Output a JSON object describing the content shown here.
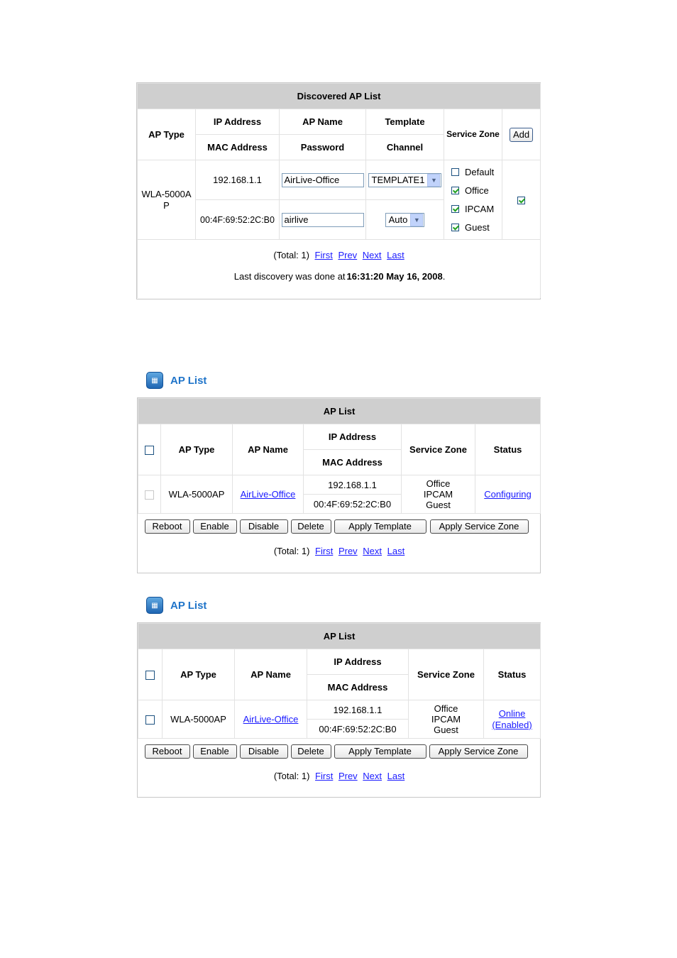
{
  "discovered": {
    "title": "Discovered AP List",
    "headers": {
      "ap_type": "AP Type",
      "ip_address": "IP Address",
      "mac_address": "MAC Address",
      "ap_name": "AP Name",
      "password": "Password",
      "template": "Template",
      "channel": "Channel",
      "service_zone": "Service Zone",
      "add_button": "Add"
    },
    "row": {
      "ap_type": "WLA-5000AP",
      "ip": "192.168.1.1",
      "mac": "00:4F:69:52:2C:B0",
      "ap_name_value": "AirLive-Office",
      "password_value": "airlive",
      "template_value": "TEMPLATE1",
      "channel_value": "Auto",
      "zones": [
        {
          "label": "Default",
          "checked": false
        },
        {
          "label": "Office",
          "checked": true
        },
        {
          "label": "IPCAM",
          "checked": true
        },
        {
          "label": "Guest",
          "checked": true
        }
      ],
      "add_checked": true
    },
    "pager": {
      "total": "(Total: 1)",
      "first": "First",
      "prev": "Prev",
      "next": "Next",
      "last": "Last"
    },
    "discovery_prefix": "Last discovery was done at",
    "discovery_time": "16:31:20 May 16, 2008",
    "discovery_suffix": "."
  },
  "ap_list_1": {
    "heading": "AP List",
    "title": "AP List",
    "headers": {
      "ap_type": "AP Type",
      "ap_name": "AP Name",
      "ip_address": "IP Address",
      "mac_address": "MAC Address",
      "service_zone": "Service Zone",
      "status": "Status"
    },
    "row": {
      "ap_type": "WLA-5000AP",
      "ap_name": "AirLive-Office",
      "ip": "192.168.1.1",
      "mac": "00:4F:69:52:2C:B0",
      "zones": [
        "Office",
        "IPCAM",
        "Guest"
      ],
      "status": "Configuring"
    },
    "buttons": {
      "reboot": "Reboot",
      "enable": "Enable",
      "disable": "Disable",
      "delete": "Delete",
      "apply_template": "Apply Template",
      "apply_zone": "Apply Service Zone"
    },
    "pager": {
      "total": "(Total: 1)",
      "first": "First",
      "prev": "Prev",
      "next": "Next",
      "last": "Last"
    }
  },
  "ap_list_2": {
    "heading": "AP List",
    "title": "AP List",
    "headers": {
      "ap_type": "AP Type",
      "ap_name": "AP Name",
      "ip_address": "IP Address",
      "mac_address": "MAC Address",
      "service_zone": "Service Zone",
      "status": "Status"
    },
    "row": {
      "ap_type": "WLA-5000AP",
      "ap_name": "AirLive-Office",
      "ip": "192.168.1.1",
      "mac": "00:4F:69:52:2C:B0",
      "zones": [
        "Office",
        "IPCAM",
        "Guest"
      ],
      "status_line1": "Online",
      "status_line2": "(Enabled)"
    },
    "buttons": {
      "reboot": "Reboot",
      "enable": "Enable",
      "disable": "Disable",
      "delete": "Delete",
      "apply_template": "Apply Template",
      "apply_zone": "Apply Service Zone"
    },
    "pager": {
      "total": "(Total: 1)",
      "first": "First",
      "prev": "Prev",
      "next": "Next",
      "last": "Last"
    }
  }
}
